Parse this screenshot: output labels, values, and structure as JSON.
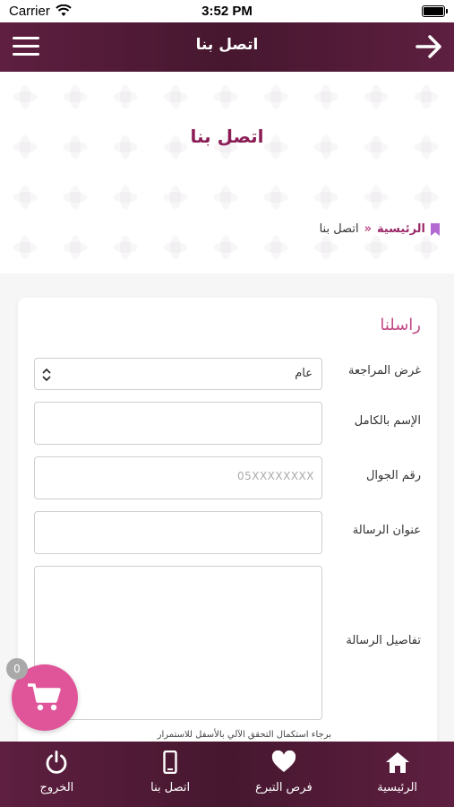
{
  "status_bar": {
    "carrier": "Carrier",
    "time": "3:52 PM"
  },
  "header": {
    "title": "اتصل بنا",
    "menu_icon": "hamburger-menu-icon",
    "back_icon": "arrow-right-icon"
  },
  "hero": {
    "title": "اتصل بنا"
  },
  "breadcrumb": {
    "home": "الرئيسية",
    "separator": "»",
    "current": "اتصل بنا"
  },
  "form": {
    "title": "راسلنا",
    "purpose_label": "غرض المراجعة",
    "purpose_value": "عام",
    "fullname_label": "الإسم بالكامل",
    "mobile_label": "رقم الجوال",
    "mobile_placeholder": "05XXXXXXXX",
    "subject_label": "عنوان الرسالة",
    "details_label": "تفاصيل الرسالة",
    "hint": "برجاء استكمال التحقق الآلي بالأسفل للاستمرار"
  },
  "cart": {
    "count": "0"
  },
  "nav": {
    "items": [
      {
        "label": "الرئيسية",
        "icon": "home-icon"
      },
      {
        "label": "فرص التبرع",
        "icon": "heart-icon"
      },
      {
        "label": "اتصل بنا",
        "icon": "mobile-phone-icon"
      },
      {
        "label": "الخروج",
        "icon": "power-icon"
      }
    ]
  },
  "colors": {
    "primary": "#5e1f40",
    "accent": "#8b1d55",
    "pink": "#e0559a"
  }
}
